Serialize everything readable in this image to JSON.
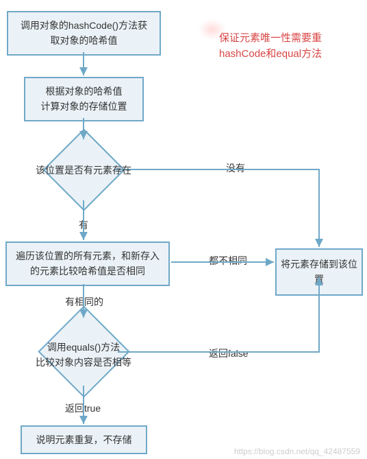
{
  "chart_data": {
    "type": "flowchart",
    "title": "",
    "nodes": [
      {
        "id": "n1",
        "kind": "process",
        "text": "调用对象的hashCode()方法获取对象的哈希值"
      },
      {
        "id": "n2",
        "kind": "process",
        "text": "根据对象的哈希值计算对象的存储位置"
      },
      {
        "id": "n3",
        "kind": "decision",
        "text": "该位置是否有元素存在"
      },
      {
        "id": "n4",
        "kind": "process",
        "text": "遍历该位置的所有元素，和新存入的元素比较哈希值是否相同"
      },
      {
        "id": "n5",
        "kind": "decision",
        "text": "调用equals()方法比较对象内容是否相等"
      },
      {
        "id": "n6",
        "kind": "process",
        "text": "说明元素重复，不存储"
      },
      {
        "id": "n7",
        "kind": "process",
        "text": "将元素存储到该位置"
      }
    ],
    "edges": [
      {
        "from": "n1",
        "to": "n2",
        "label": ""
      },
      {
        "from": "n2",
        "to": "n3",
        "label": ""
      },
      {
        "from": "n3",
        "to": "n4",
        "label": "有"
      },
      {
        "from": "n3",
        "to": "n7",
        "label": "没有"
      },
      {
        "from": "n4",
        "to": "n5",
        "label": "有相同的"
      },
      {
        "from": "n4",
        "to": "n7",
        "label": "都不相同"
      },
      {
        "from": "n5",
        "to": "n6",
        "label": "返回true"
      },
      {
        "from": "n5",
        "to": "n7",
        "label": "返回false"
      }
    ],
    "annotation": "保证元素唯一性需要重写hashCode和equal方法",
    "watermark": "https://blog.csdn.net/qq_42487559"
  },
  "nodes": {
    "n1_l1": "调用对象的hashCode()方法获",
    "n1_l2": "取对象的哈希值",
    "n2_l1": "根据对象的哈希值",
    "n2_l2": "计算对象的存储位置",
    "n3": "该位置是否有元素存在",
    "n4_l1": "遍历该位置的所有元素，和新存入",
    "n4_l2": "的元素比较哈希值是否相同",
    "n5_l1": "调用equals()方法",
    "n5_l2": "比较对象内容是否相等",
    "n6": "说明元素重复，不存储",
    "n7": "将元素存储到该位置"
  },
  "labels": {
    "no_exist": "没有",
    "has": "有",
    "all_diff": "都不相同",
    "has_same": "有相同的",
    "ret_false": "返回false",
    "ret_true": "返回true"
  },
  "annotation_l1": "保证元素唯一性需要重",
  "annotation_l2": "hashCode和equal方法",
  "watermark": "https://blog.csdn.net/qq_42487559"
}
